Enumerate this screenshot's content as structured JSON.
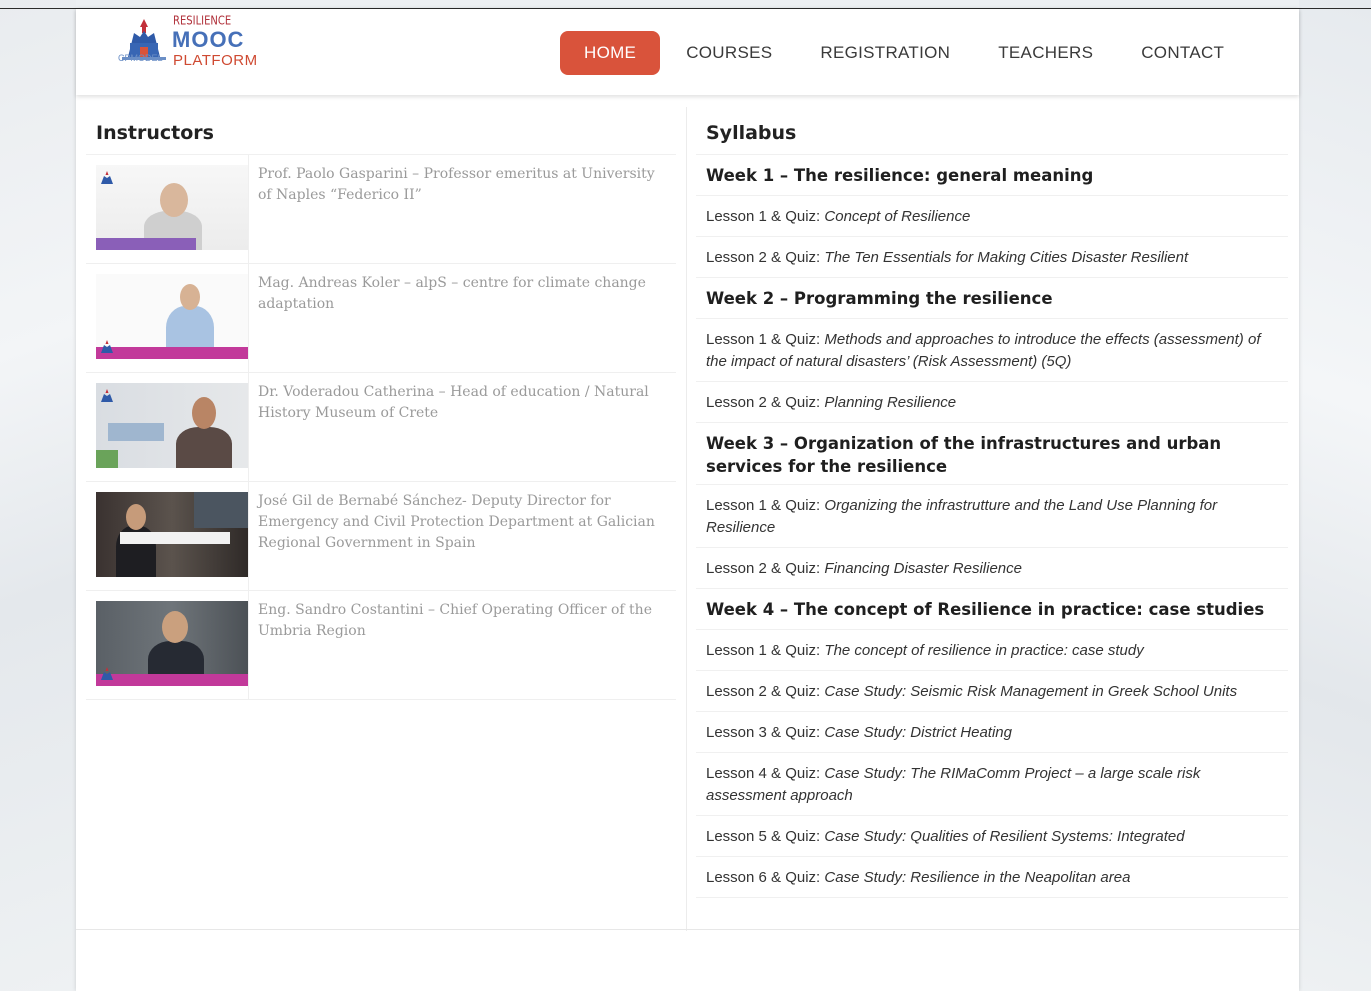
{
  "brand": {
    "line1": "RESILIENCE",
    "line2": "MOOC",
    "line3": "PLATFORM",
    "sub": "CPMODEL"
  },
  "nav": [
    {
      "label": "HOME",
      "active": true
    },
    {
      "label": "COURSES",
      "active": false
    },
    {
      "label": "REGISTRATION",
      "active": false
    },
    {
      "label": "TEACHERS",
      "active": false
    },
    {
      "label": "CONTACT",
      "active": false
    }
  ],
  "instructors": {
    "title": "Instructors",
    "items": [
      {
        "text": "Prof. Paolo Gasparini – Professor emeritus at University of Naples “Federico II”"
      },
      {
        "text": "Mag. Andreas Koler – alpS – centre for climate change adaptation"
      },
      {
        "text": "Dr. Voderadou Catherina – Head of education / Natural History Museum of Crete"
      },
      {
        "text": "José Gil de Bernabé Sánchez- Deputy Director for Emergency and Civil Protection Department at Galician Regional Government in Spain"
      },
      {
        "text": "Eng. Sandro Costantini – Chief Operating Officer of the Umbria Region"
      }
    ]
  },
  "syllabus": {
    "title": "Syllabus",
    "weeks": [
      {
        "title": "Week 1 – The resilience: general meaning",
        "lessons": [
          {
            "prefix": "Lesson 1 & Quiz:",
            "title": "Concept of Resilience"
          },
          {
            "prefix": "Lesson 2 & Quiz:",
            "title": "The Ten Essentials for Making Cities Disaster Resilient"
          }
        ]
      },
      {
        "title": "Week 2 – Programming the resilience",
        "lessons": [
          {
            "prefix": "Lesson 1 & Quiz:",
            "title": "Methods and approaches to introduce the effects (assessment) of the impact of natural disasters’ (Risk Assessment) (5Q)"
          },
          {
            "prefix": "Lesson 2 & Quiz:",
            "title": "Planning Resilience"
          }
        ]
      },
      {
        "title": "Week 3 – Organization of the infrastructures and urban services for the resilience",
        "lessons": [
          {
            "prefix": "Lesson 1 & Quiz:",
            "title": "Organizing the infrastrutture and the Land Use Planning for Resilience"
          },
          {
            "prefix": "Lesson 2 & Quiz:",
            "title": "Financing Disaster Resilience"
          }
        ]
      },
      {
        "title": "Week 4 – The concept of Resilience in practice: case studies",
        "lessons": [
          {
            "prefix": "Lesson 1 & Quiz:",
            "title": "The concept of resilience in practice: case study"
          },
          {
            "prefix": "Lesson 2 & Quiz:",
            "title": "Case Study: Seismic Risk Management in Greek School Units"
          },
          {
            "prefix": "Lesson 3 & Quiz:",
            "title": "Case Study: District Heating"
          },
          {
            "prefix": "Lesson 4 & Quiz:",
            "title": "Case Study: The RIMaComm Project – a large scale risk assessment approach"
          },
          {
            "prefix": "Lesson 5 & Quiz:",
            "title": "Case Study: Qualities of Resilient Systems: Integrated"
          },
          {
            "prefix": "Lesson 6 & Quiz:",
            "title": "Case Study: Resilience in the Neapolitan area"
          }
        ]
      }
    ]
  },
  "colors": {
    "accent": "#d9533b",
    "brand_blue": "#4670b8",
    "brand_red": "#cf4a32",
    "lower_third": "#c2399a"
  }
}
